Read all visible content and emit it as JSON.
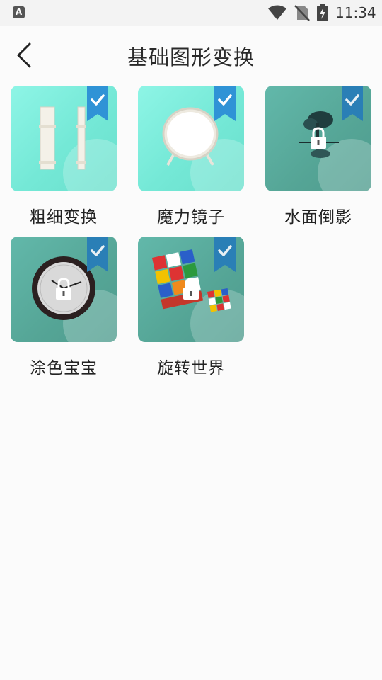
{
  "status_bar": {
    "time": "11:34",
    "app_icon_letter": "A",
    "icons": [
      "app-notification-icon",
      "wifi-icon",
      "no-sim-icon",
      "battery-charging-icon"
    ]
  },
  "header": {
    "title": "基础图形变换",
    "back_icon": "chevron-left-icon"
  },
  "lessons": [
    {
      "label": "粗细变换",
      "locked": false,
      "completed": true,
      "image": "pillars"
    },
    {
      "label": "魔力镜子",
      "locked": false,
      "completed": true,
      "image": "mirror"
    },
    {
      "label": "水面倒影",
      "locked": true,
      "completed": true,
      "image": "tree-reflection"
    },
    {
      "label": "涂色宝宝",
      "locked": true,
      "completed": true,
      "image": "clock"
    },
    {
      "label": "旋转世界",
      "locked": true,
      "completed": true,
      "image": "rubiks-cube"
    }
  ],
  "colors": {
    "unlocked_card": "#7cefdc",
    "locked_card": "#57a899",
    "ribbon": "#2f93d6",
    "page_bg": "#fbfbfb"
  }
}
